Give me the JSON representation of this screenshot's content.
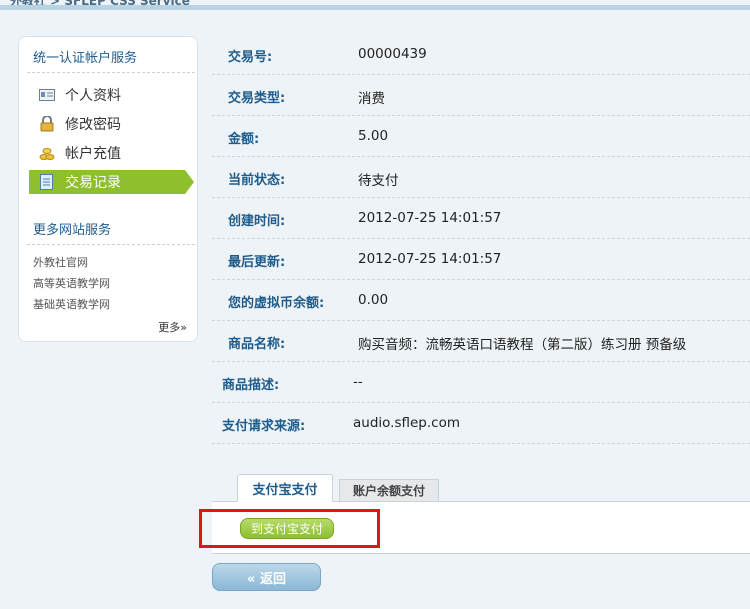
{
  "header": {
    "breadcrumb": "外教社 > SFLEP CSS Service"
  },
  "sidebar": {
    "section1_title": "统一认证帐户服务",
    "items": [
      {
        "label": "个人资料",
        "icon": "profile-card-icon"
      },
      {
        "label": "修改密码",
        "icon": "lock-icon"
      },
      {
        "label": "帐户充值",
        "icon": "coins-icon"
      },
      {
        "label": "交易记录",
        "icon": "document-icon",
        "active": true
      }
    ],
    "section2_title": "更多网站服务",
    "links": [
      "外教社官网",
      "高等英语教学网",
      "基础英语教学网"
    ],
    "more_label": "更多»"
  },
  "transaction": {
    "rows": [
      {
        "label": "交易号:",
        "value": "00000439"
      },
      {
        "label": "交易类型:",
        "value": "消费"
      },
      {
        "label": "金额:",
        "value": "5.00"
      },
      {
        "label": "当前状态:",
        "value": "待支付"
      },
      {
        "label": "创建时间:",
        "value": "2012-07-25 14:01:57"
      },
      {
        "label": "最后更新:",
        "value": "2012-07-25 14:01:57"
      },
      {
        "label": "您的虚拟币余额:",
        "value": "0.00"
      },
      {
        "label": "商品名称:",
        "value": "购买音频：流畅英语口语教程（第二版）练习册 预备级"
      },
      {
        "label": "商品描述:",
        "value": "--"
      },
      {
        "label": "支付请求来源:",
        "value": "audio.sflep.com"
      }
    ]
  },
  "payment": {
    "tabs": [
      "支付宝支付",
      "账户余额支付"
    ],
    "pay_button": "到支付宝支付",
    "back_button": "«  返回"
  },
  "colors": {
    "accent_green": "#8dbf2f",
    "label_blue": "#1f5c8c",
    "highlight_red": "#e01515"
  }
}
